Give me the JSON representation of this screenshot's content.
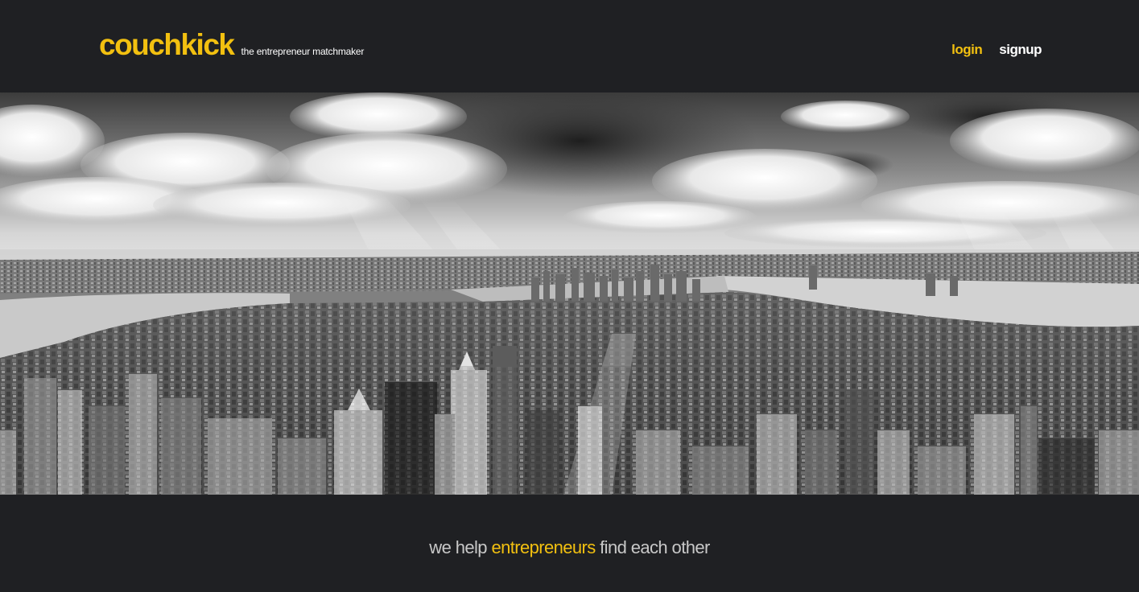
{
  "brand": {
    "logo": "couchkick",
    "tagline": "the entrepreneur matchmaker"
  },
  "nav": {
    "login": "login",
    "signup": "signup"
  },
  "slogan": {
    "before": "we help ",
    "highlight": "entrepreneurs",
    "after": " find each other"
  },
  "colors": {
    "background": "#1f2023",
    "accent": "#f2c010",
    "text_light": "#ffffff",
    "text_muted": "#c8c8c8"
  }
}
